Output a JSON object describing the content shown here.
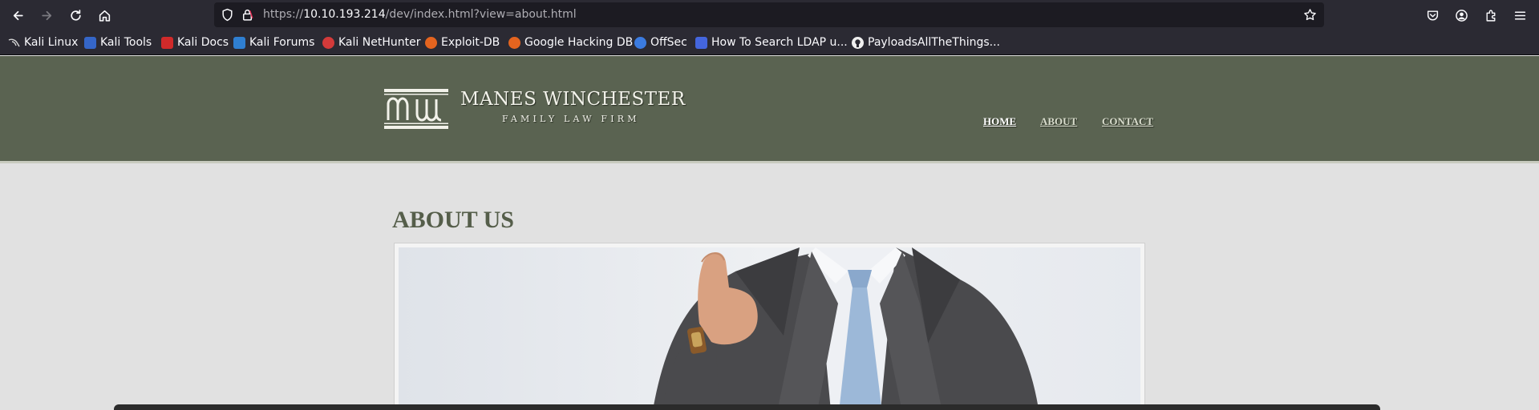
{
  "browser": {
    "url": {
      "scheme": "https://",
      "host": "10.10.193.214",
      "path": "/dev/index.html?view=about.html"
    },
    "icons": [
      "back-icon",
      "forward-icon",
      "reload-icon",
      "home-icon",
      "shield-icon",
      "lock-icon",
      "star-icon",
      "pocket-icon",
      "account-icon",
      "extensions-icon",
      "menu-icon"
    ],
    "bookmarks": [
      {
        "label": "Kali Linux",
        "icon": "kali-linux-icon",
        "color": "#1a1a1a"
      },
      {
        "label": "Kali Tools",
        "icon": "kali-tools-icon",
        "color": "#3566c8"
      },
      {
        "label": "Kali Docs",
        "icon": "kali-docs-icon",
        "color": "#d02a2a"
      },
      {
        "label": "Kali Forums",
        "icon": "kali-forums-icon",
        "color": "#2f7fd1"
      },
      {
        "label": "Kali NetHunter",
        "icon": "kali-nethunter-icon",
        "color": "#d33a3a"
      },
      {
        "label": "Exploit-DB",
        "icon": "exploit-db-icon",
        "color": "#e4641f"
      },
      {
        "label": "Google Hacking DB",
        "icon": "ghdb-icon",
        "color": "#e4641f"
      },
      {
        "label": "OffSec",
        "icon": "offsec-icon",
        "color": "#3b7be0"
      },
      {
        "label": "How To Search LDAP u...",
        "icon": "ldap-article-icon",
        "color": "#4466dd"
      },
      {
        "label": "PayloadsAllTheThings...",
        "icon": "github-icon",
        "color": "#f0f0f0"
      }
    ]
  },
  "site": {
    "brand_name": "MANES WINCHESTER",
    "brand_tagline": "FAMILY LAW FIRM",
    "logo_letters": "MW",
    "nav": [
      {
        "label": "HOME"
      },
      {
        "label": "ABOUT"
      },
      {
        "label": "CONTACT"
      }
    ],
    "heading": "ABOUT US",
    "colors": {
      "header_bg": "#5a6351",
      "page_bg": "#e1e1e1",
      "heading_color": "#555e4a"
    }
  }
}
